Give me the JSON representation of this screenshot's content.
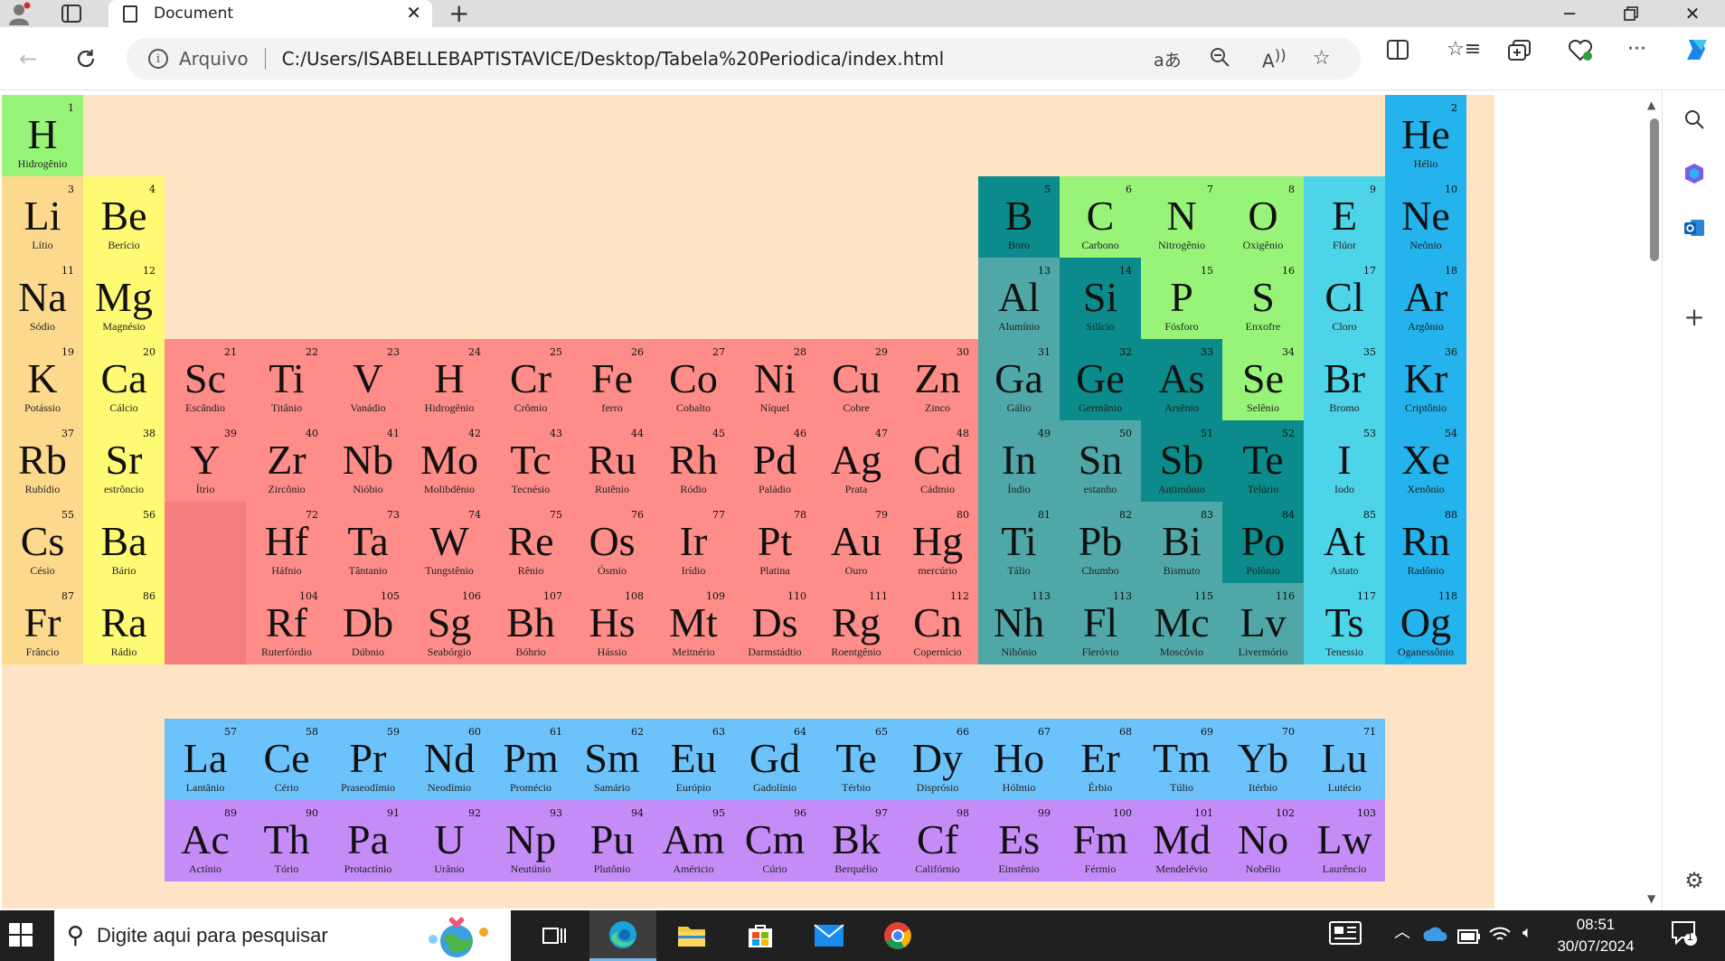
{
  "browser": {
    "tab_title": "Document",
    "new_tab_symbol": "+",
    "address_prefix": "Arquivo",
    "url": "C:/Users/ISABELLEBAPTISTAVICE/Desktop/Tabela%20Periodica/index.html"
  },
  "colors": {
    "hydrogen": "#98f479",
    "alkali": "#fcd98d",
    "alkaline": "#fffa74",
    "transition": "#fe8c88",
    "placeholder": "#f57e7e",
    "post_transition": "#4fa8a7",
    "metalloid": "#0b8b8b",
    "nonmetal": "#98f479",
    "halogen": "#4ed4e8",
    "noble": "#24b3ec",
    "lanthanide": "#6cc3fc",
    "actinide": "#c58cf8",
    "page_bg": "#fee4c4"
  },
  "elements": [
    {
      "n": "1",
      "s": "H",
      "m": "Hidrogênio",
      "c": "#98f479"
    },
    {
      "n": "2",
      "s": "He",
      "m": "Hélio",
      "c": "#24b3ec"
    },
    {
      "n": "3",
      "s": "Li",
      "m": "Lítio",
      "c": "#fcd98d"
    },
    {
      "n": "4",
      "s": "Be",
      "m": "Berício",
      "c": "#fffa74"
    },
    {
      "n": "5",
      "s": "B",
      "m": "Boro",
      "c": "#0b8b8b"
    },
    {
      "n": "6",
      "s": "C",
      "m": "Carbono",
      "c": "#98f479"
    },
    {
      "n": "7",
      "s": "N",
      "m": "Nitrogênio",
      "c": "#98f479"
    },
    {
      "n": "8",
      "s": "O",
      "m": "Oxigênio",
      "c": "#98f479"
    },
    {
      "n": "9",
      "s": "E",
      "m": "Flúor",
      "c": "#4ed4e8"
    },
    {
      "n": "10",
      "s": "Ne",
      "m": "Neônio",
      "c": "#24b3ec"
    },
    {
      "n": "11",
      "s": "Na",
      "m": "Sódio",
      "c": "#fcd98d"
    },
    {
      "n": "12",
      "s": "Mg",
      "m": "Magnésio",
      "c": "#fffa74"
    },
    {
      "n": "13",
      "s": "Al",
      "m": "Alumínio",
      "c": "#4fa8a7"
    },
    {
      "n": "14",
      "s": "Si",
      "m": "Silício",
      "c": "#0b8b8b"
    },
    {
      "n": "15",
      "s": "P",
      "m": "Fósforo",
      "c": "#98f479"
    },
    {
      "n": "16",
      "s": "S",
      "m": "Enxofre",
      "c": "#98f479"
    },
    {
      "n": "17",
      "s": "Cl",
      "m": "Cloro",
      "c": "#4ed4e8"
    },
    {
      "n": "18",
      "s": "Ar",
      "m": "Argônio",
      "c": "#24b3ec"
    },
    {
      "n": "19",
      "s": "K",
      "m": "Potássio",
      "c": "#fcd98d"
    },
    {
      "n": "20",
      "s": "Ca",
      "m": "Cálcio",
      "c": "#fffa74"
    },
    {
      "n": "21",
      "s": "Sc",
      "m": "Escândio",
      "c": "#fe8c88"
    },
    {
      "n": "22",
      "s": "Ti",
      "m": "Titânio",
      "c": "#fe8c88"
    },
    {
      "n": "23",
      "s": "V",
      "m": "Vanádio",
      "c": "#fe8c88"
    },
    {
      "n": "24",
      "s": "H",
      "m": "Hidrogênio",
      "c": "#fe8c88"
    },
    {
      "n": "25",
      "s": "Cr",
      "m": "Crômio",
      "c": "#fe8c88"
    },
    {
      "n": "26",
      "s": "Fe",
      "m": "ferro",
      "c": "#fe8c88"
    },
    {
      "n": "27",
      "s": "Co",
      "m": "Cobalto",
      "c": "#fe8c88"
    },
    {
      "n": "28",
      "s": "Ni",
      "m": "Níquel",
      "c": "#fe8c88"
    },
    {
      "n": "29",
      "s": "Cu",
      "m": "Cobre",
      "c": "#fe8c88"
    },
    {
      "n": "30",
      "s": "Zn",
      "m": "Zinco",
      "c": "#fe8c88"
    },
    {
      "n": "31",
      "s": "Ga",
      "m": "Gálio",
      "c": "#4fa8a7"
    },
    {
      "n": "32",
      "s": "Ge",
      "m": "Germânio",
      "c": "#0b8b8b"
    },
    {
      "n": "33",
      "s": "As",
      "m": "Arsênio",
      "c": "#0b8b8b"
    },
    {
      "n": "34",
      "s": "Se",
      "m": "Selênio",
      "c": "#98f479"
    },
    {
      "n": "35",
      "s": "Br",
      "m": "Bromo",
      "c": "#4ed4e8"
    },
    {
      "n": "36",
      "s": "Kr",
      "m": "Criptônio",
      "c": "#24b3ec"
    },
    {
      "n": "37",
      "s": "Rb",
      "m": "Rubídio",
      "c": "#fcd98d"
    },
    {
      "n": "38",
      "s": "Sr",
      "m": "estrôncio",
      "c": "#fffa74"
    },
    {
      "n": "39",
      "s": "Y",
      "m": "Ítrio",
      "c": "#fe8c88"
    },
    {
      "n": "40",
      "s": "Zr",
      "m": "Zircônio",
      "c": "#fe8c88"
    },
    {
      "n": "41",
      "s": "Nb",
      "m": "Nióbio",
      "c": "#fe8c88"
    },
    {
      "n": "42",
      "s": "Mo",
      "m": "Molibdênio",
      "c": "#fe8c88"
    },
    {
      "n": "43",
      "s": "Tc",
      "m": "Tecnésio",
      "c": "#fe8c88"
    },
    {
      "n": "44",
      "s": "Ru",
      "m": "Rutênio",
      "c": "#fe8c88"
    },
    {
      "n": "45",
      "s": "Rh",
      "m": "Ródio",
      "c": "#fe8c88"
    },
    {
      "n": "46",
      "s": "Pd",
      "m": "Paládio",
      "c": "#fe8c88"
    },
    {
      "n": "47",
      "s": "Ag",
      "m": "Prata",
      "c": "#fe8c88"
    },
    {
      "n": "48",
      "s": "Cd",
      "m": "Cádmio",
      "c": "#fe8c88"
    },
    {
      "n": "49",
      "s": "In",
      "m": "Índio",
      "c": "#4fa8a7"
    },
    {
      "n": "50",
      "s": "Sn",
      "m": "estanho",
      "c": "#4fa8a7"
    },
    {
      "n": "51",
      "s": "Sb",
      "m": "Antimônio",
      "c": "#0b8b8b"
    },
    {
      "n": "52",
      "s": "Te",
      "m": "Telúrio",
      "c": "#0b8b8b"
    },
    {
      "n": "53",
      "s": "I",
      "m": "Iodo",
      "c": "#4ed4e8"
    },
    {
      "n": "54",
      "s": "Xe",
      "m": "Xenônio",
      "c": "#24b3ec"
    },
    {
      "n": "55",
      "s": "Cs",
      "m": "Césio",
      "c": "#fcd98d"
    },
    {
      "n": "56",
      "s": "Ba",
      "m": "Bário",
      "c": "#fffa74"
    },
    {
      "n": "",
      "s": "",
      "m": "",
      "c": "#f57e7e"
    },
    {
      "n": "72",
      "s": "Hf",
      "m": "Háfnio",
      "c": "#fe8c88"
    },
    {
      "n": "73",
      "s": "Ta",
      "m": "Tântanio",
      "c": "#fe8c88"
    },
    {
      "n": "74",
      "s": "W",
      "m": "Tungstênio",
      "c": "#fe8c88"
    },
    {
      "n": "75",
      "s": "Re",
      "m": "Rênio",
      "c": "#fe8c88"
    },
    {
      "n": "76",
      "s": "Os",
      "m": "Ósmio",
      "c": "#fe8c88"
    },
    {
      "n": "77",
      "s": "Ir",
      "m": "Irídio",
      "c": "#fe8c88"
    },
    {
      "n": "78",
      "s": "Pt",
      "m": "Platina",
      "c": "#fe8c88"
    },
    {
      "n": "79",
      "s": "Au",
      "m": "Ouro",
      "c": "#fe8c88"
    },
    {
      "n": "80",
      "s": "Hg",
      "m": "mercúrio",
      "c": "#fe8c88"
    },
    {
      "n": "81",
      "s": "Ti",
      "m": "Tálio",
      "c": "#4fa8a7"
    },
    {
      "n": "82",
      "s": "Pb",
      "m": "Chumbo",
      "c": "#4fa8a7"
    },
    {
      "n": "83",
      "s": "Bi",
      "m": "Bismuto",
      "c": "#4fa8a7"
    },
    {
      "n": "84",
      "s": "Po",
      "m": "Polônio",
      "c": "#0b8b8b"
    },
    {
      "n": "85",
      "s": "At",
      "m": "Astato",
      "c": "#4ed4e8"
    },
    {
      "n": "88",
      "s": "Rn",
      "m": "Radônio",
      "c": "#24b3ec"
    },
    {
      "n": "87",
      "s": "Fr",
      "m": "Frâncio",
      "c": "#fcd98d"
    },
    {
      "n": "86",
      "s": "Ra",
      "m": "Rádio",
      "c": "#fffa74"
    },
    {
      "n": "",
      "s": "",
      "m": "",
      "c": "#f57e7e"
    },
    {
      "n": "104",
      "s": "Rf",
      "m": "Ruterfórdio",
      "c": "#fe8c88"
    },
    {
      "n": "105",
      "s": "Db",
      "m": "Dúbnio",
      "c": "#fe8c88"
    },
    {
      "n": "106",
      "s": "Sg",
      "m": "Seabórgio",
      "c": "#fe8c88"
    },
    {
      "n": "107",
      "s": "Bh",
      "m": "Bóhrio",
      "c": "#fe8c88"
    },
    {
      "n": "108",
      "s": "Hs",
      "m": "Hássio",
      "c": "#fe8c88"
    },
    {
      "n": "109",
      "s": "Mt",
      "m": "Meitnério",
      "c": "#fe8c88"
    },
    {
      "n": "110",
      "s": "Ds",
      "m": "Darmstádtio",
      "c": "#fe8c88"
    },
    {
      "n": "111",
      "s": "Rg",
      "m": "Roentgênio",
      "c": "#fe8c88"
    },
    {
      "n": "112",
      "s": "Cn",
      "m": "Copernício",
      "c": "#fe8c88"
    },
    {
      "n": "113",
      "s": "Nh",
      "m": "Nihônio",
      "c": "#4fa8a7"
    },
    {
      "n": "113",
      "s": "Fl",
      "m": "Fleróvio",
      "c": "#4fa8a7"
    },
    {
      "n": "115",
      "s": "Mc",
      "m": "Moscóvio",
      "c": "#4fa8a7"
    },
    {
      "n": "116",
      "s": "Lv",
      "m": "Livermório",
      "c": "#4fa8a7"
    },
    {
      "n": "117",
      "s": "Ts",
      "m": "Tenessio",
      "c": "#4ed4e8"
    },
    {
      "n": "118",
      "s": "Og",
      "m": "Oganessônio",
      "c": "#24b3ec"
    },
    {
      "n": "57",
      "s": "La",
      "m": "Lantânio",
      "c": "#6cc3fc"
    },
    {
      "n": "58",
      "s": "Ce",
      "m": "Cério",
      "c": "#6cc3fc"
    },
    {
      "n": "59",
      "s": "Pr",
      "m": "Praseodímio",
      "c": "#6cc3fc"
    },
    {
      "n": "60",
      "s": "Nd",
      "m": "Neodímio",
      "c": "#6cc3fc"
    },
    {
      "n": "61",
      "s": "Pm",
      "m": "Promécio",
      "c": "#6cc3fc"
    },
    {
      "n": "62",
      "s": "Sm",
      "m": "Samário",
      "c": "#6cc3fc"
    },
    {
      "n": "63",
      "s": "Eu",
      "m": "Európio",
      "c": "#6cc3fc"
    },
    {
      "n": "64",
      "s": "Gd",
      "m": "Gadolínio",
      "c": "#6cc3fc"
    },
    {
      "n": "65",
      "s": "Te",
      "m": "Térbio",
      "c": "#6cc3fc"
    },
    {
      "n": "66",
      "s": "Dy",
      "m": "Disprósio",
      "c": "#6cc3fc"
    },
    {
      "n": "67",
      "s": "Ho",
      "m": "Hólmio",
      "c": "#6cc3fc"
    },
    {
      "n": "68",
      "s": "Er",
      "m": "Érbio",
      "c": "#6cc3fc"
    },
    {
      "n": "69",
      "s": "Tm",
      "m": "Túlio",
      "c": "#6cc3fc"
    },
    {
      "n": "70",
      "s": "Yb",
      "m": "Itérbio",
      "c": "#6cc3fc"
    },
    {
      "n": "71",
      "s": "Lu",
      "m": "Lutécio",
      "c": "#6cc3fc"
    },
    {
      "n": "89",
      "s": "Ac",
      "m": "Actínio",
      "c": "#c58cf8"
    },
    {
      "n": "90",
      "s": "Th",
      "m": "Tório",
      "c": "#c58cf8"
    },
    {
      "n": "91",
      "s": "Pa",
      "m": "Protactínio",
      "c": "#c58cf8"
    },
    {
      "n": "92",
      "s": "U",
      "m": "Urânio",
      "c": "#c58cf8"
    },
    {
      "n": "93",
      "s": "Np",
      "m": "Neutúnio",
      "c": "#c58cf8"
    },
    {
      "n": "94",
      "s": "Pu",
      "m": "Plutônio",
      "c": "#c58cf8"
    },
    {
      "n": "95",
      "s": "Am",
      "m": "Américio",
      "c": "#c58cf8"
    },
    {
      "n": "96",
      "s": "Cm",
      "m": "Cúrio",
      "c": "#c58cf8"
    },
    {
      "n": "97",
      "s": "Bk",
      "m": "Berquélio",
      "c": "#c58cf8"
    },
    {
      "n": "98",
      "s": "Cf",
      "m": "Califórnio",
      "c": "#c58cf8"
    },
    {
      "n": "99",
      "s": "Es",
      "m": "Einstênio",
      "c": "#c58cf8"
    },
    {
      "n": "100",
      "s": "Fm",
      "m": "Férmio",
      "c": "#c58cf8"
    },
    {
      "n": "101",
      "s": "Md",
      "m": "Mendelévio",
      "c": "#c58cf8"
    },
    {
      "n": "102",
      "s": "No",
      "m": "Nobélio",
      "c": "#c58cf8"
    },
    {
      "n": "103",
      "s": "Lw",
      "m": "Laurêncio",
      "c": "#c58cf8"
    }
  ],
  "taskbar": {
    "search_placeholder": "Digite aqui para pesquisar",
    "time": "08:51",
    "date": "30/07/2024",
    "notification_count": "1"
  }
}
